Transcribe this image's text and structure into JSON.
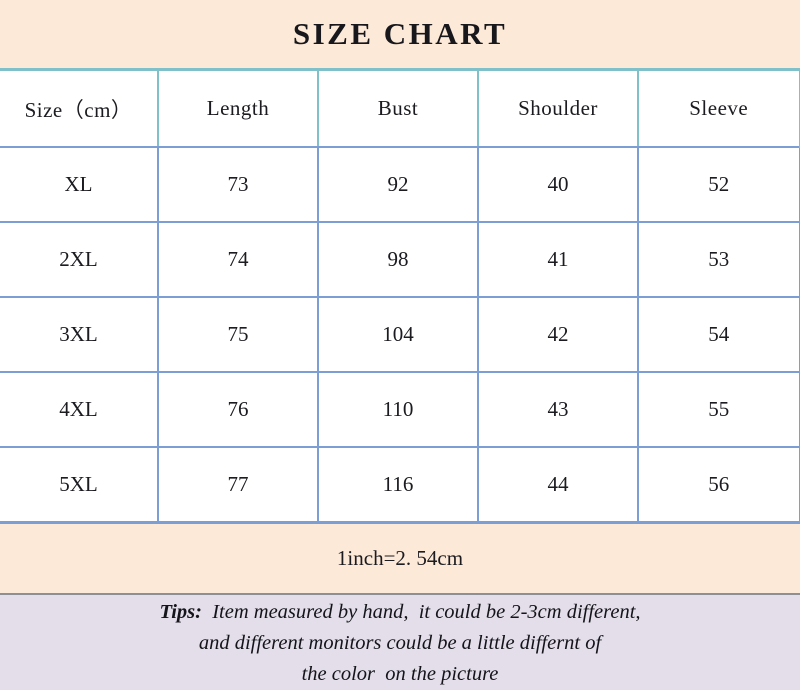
{
  "title": "SIZE CHART",
  "table": {
    "headers": [
      "Size（cm）",
      "Length",
      "Bust",
      "Shoulder",
      "Sleeve"
    ],
    "rows": [
      {
        "size": "XL",
        "length": "73",
        "bust": "92",
        "shoulder": "40",
        "sleeve": "52"
      },
      {
        "size": "2XL",
        "length": "74",
        "bust": "98",
        "shoulder": "41",
        "sleeve": "53"
      },
      {
        "size": "3XL",
        "length": "75",
        "bust": "104",
        "shoulder": "42",
        "sleeve": "54"
      },
      {
        "size": "4XL",
        "length": "76",
        "bust": "110",
        "shoulder": "43",
        "sleeve": "55"
      },
      {
        "size": "5XL",
        "length": "77",
        "bust": "116",
        "shoulder": "44",
        "sleeve": "56"
      }
    ]
  },
  "conversion_note": "1inch=2. 54cm",
  "tips": {
    "label": "Tips:",
    "line1_rest": "  Item measured by hand,  it could be 2-3cm different,",
    "line2": "and different monitors could be a little differnt of",
    "line3": "the color  on the picture"
  },
  "colors": {
    "banner_background": "#FCE9D8",
    "tips_background": "#E3DEE9",
    "header_border": "#7FC0CB",
    "grid_border": "#7B9FD4",
    "text": "#1B1B20",
    "table_background": "#FFFFFF"
  },
  "chart_data": {
    "type": "table",
    "title": "SIZE CHART",
    "columns": [
      "Size（cm）",
      "Length",
      "Bust",
      "Shoulder",
      "Sleeve"
    ],
    "rows": [
      [
        "XL",
        73,
        92,
        40,
        52
      ],
      [
        "2XL",
        74,
        98,
        41,
        53
      ],
      [
        "3XL",
        75,
        104,
        42,
        54
      ],
      [
        "4XL",
        76,
        110,
        43,
        55
      ],
      [
        "5XL",
        77,
        116,
        44,
        56
      ]
    ],
    "units": "cm",
    "footnote": "1inch=2. 54cm"
  }
}
